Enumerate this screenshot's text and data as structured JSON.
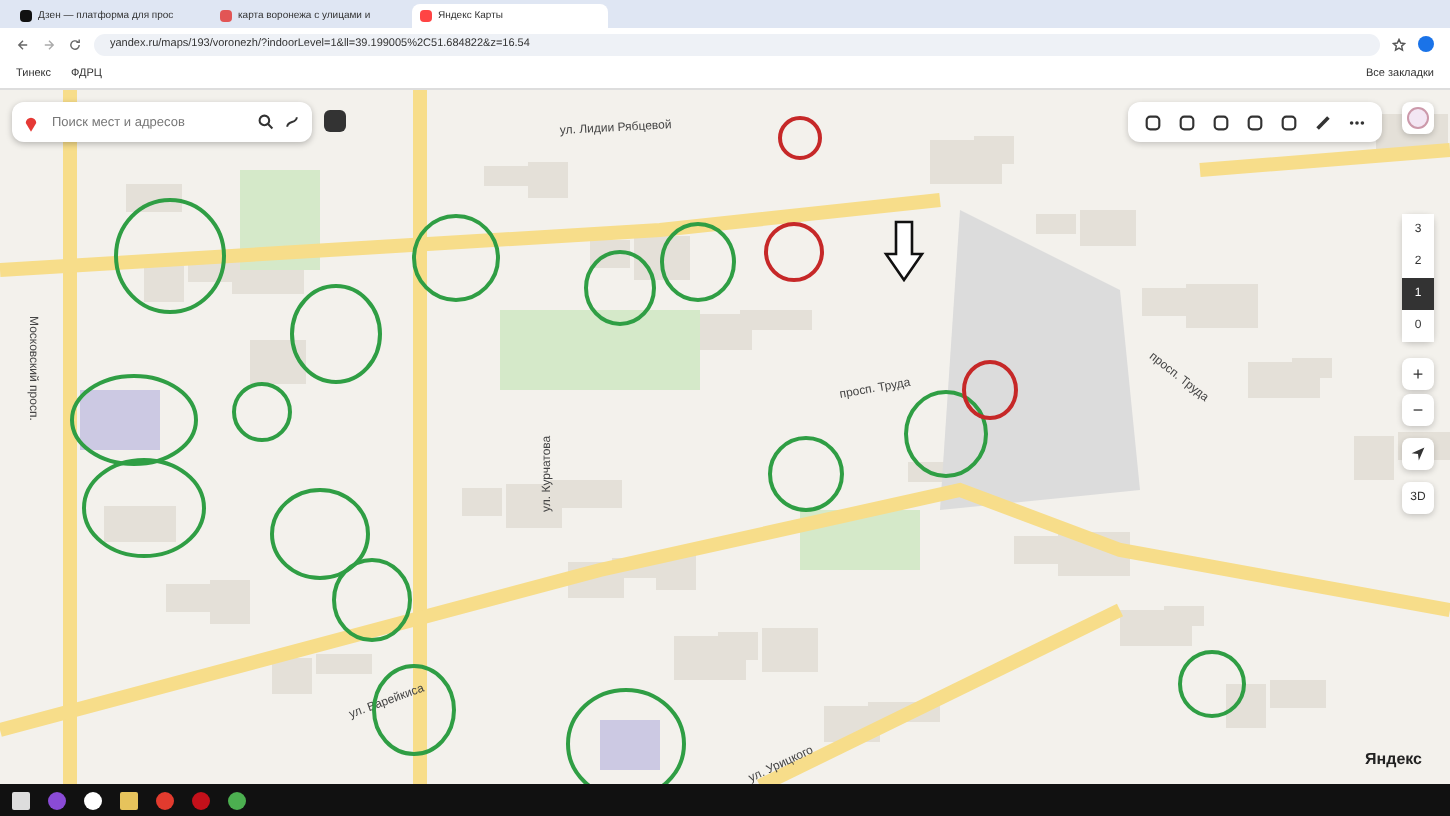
{
  "browser": {
    "tabs": [
      {
        "title": "Дзен — платформа для прос",
        "selected": false
      },
      {
        "title": "карта воронежа с улицами и",
        "selected": false
      },
      {
        "title": "Яндекс Карты",
        "selected": true
      }
    ],
    "url": "yandex.ru/maps/193/voronezh/?indoorLevel=1&ll=39.199005%2C51.684822&z=16.54",
    "bookmarks": [
      "Тинекс",
      "ФДРЦ"
    ],
    "all_bookmarks": "Все закладки"
  },
  "map": {
    "search": {
      "placeholder": "Поиск мест и адресов"
    },
    "streets": [
      {
        "name": "ул. Лидии Рябцевой"
      },
      {
        "name": "Московский просп."
      },
      {
        "name": "просп. Труда"
      },
      {
        "name": "просп. Труда"
      },
      {
        "name": "ул. Урицкого"
      },
      {
        "name": "ул. Варейкиса"
      },
      {
        "name": "ул. Курчатова"
      }
    ],
    "floors": [
      {
        "label": "3",
        "selected": false
      },
      {
        "label": "2",
        "selected": false
      },
      {
        "label": "1",
        "selected": true
      },
      {
        "label": "0",
        "selected": false
      }
    ],
    "zoom_in": "+",
    "zoom_out": "−",
    "view_3d": "3D",
    "logo": "Яндекс",
    "annotations": [
      {
        "color": "#2f9e44"
      },
      {
        "color": "#2f9e44"
      },
      {
        "color": "#2f9e44"
      },
      {
        "color": "#2f9e44"
      },
      {
        "color": "#2f9e44"
      },
      {
        "color": "#2f9e44"
      },
      {
        "color": "#2f9e44"
      },
      {
        "color": "#2f9e44"
      },
      {
        "color": "#2f9e44"
      },
      {
        "color": "#2f9e44"
      },
      {
        "color": "#2f9e44"
      },
      {
        "color": "#2f9e44"
      },
      {
        "color": "#2f9e44"
      },
      {
        "color": "#2f9e44"
      },
      {
        "color": "#2f9e44"
      },
      {
        "color": "#c62828"
      },
      {
        "color": "#c62828"
      },
      {
        "color": "#c62828"
      }
    ]
  }
}
